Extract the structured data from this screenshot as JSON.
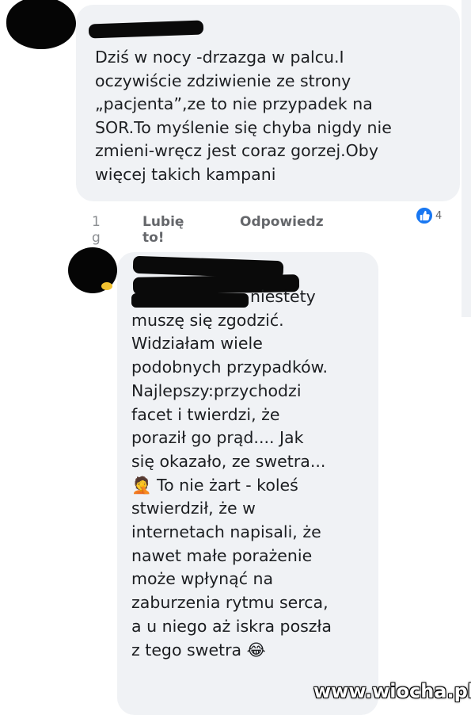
{
  "comment1": {
    "text": "Dziś w nocy -drzazga w palcu.I\noczywiście zdziwienie  ze strony\n„pacjenta”,ze to nie przypadek na\nSOR.To myślenie się chyba nigdy nie\nzmieni-wręcz jest coraz gorzej.Oby\nwięcej takich kampani",
    "time": "1 g",
    "like_label": "Lubię to!",
    "reply_label": "Odpowiedz",
    "reaction_count": "4",
    "reaction_icon": "thumbs-up-icon",
    "accent": "#1877f2"
  },
  "comment2": {
    "text": "niestety\nmuszę się zgodzić.\nWidziałam wiele\npodobnych przypadków.\nNajlepszy:przychodzi\nfacet i twierdzi, że\nporaził go prąd.... Jak\nsię okazało, ze swetra...\n🤦 To nie żart - koleś\nstwierdził, że w\ninternetach napisali, że\nnawet małe porażenie\nmoże wpłynąć na\nzaburzenia rytmu serca,\na u niego aż iskra poszła\nz tego swetra 😂"
  },
  "watermark": "www.wiocha.pl"
}
